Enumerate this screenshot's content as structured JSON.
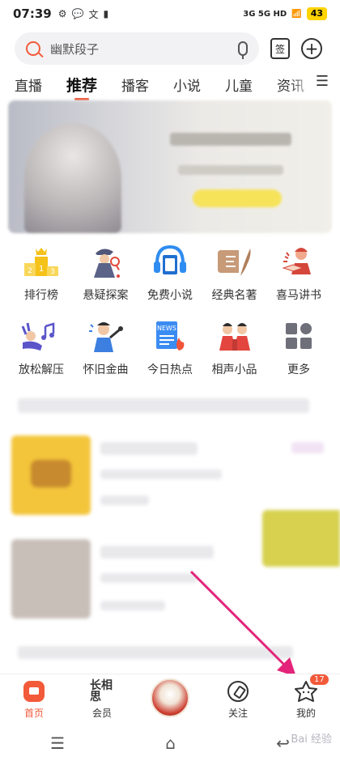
{
  "status_bar": {
    "time": "07:39",
    "network": "3G 5G HD",
    "battery": "43"
  },
  "search": {
    "placeholder": "幽默段子",
    "sign_label": "签"
  },
  "tabs": [
    "直播",
    "推荐",
    "播客",
    "小说",
    "儿童",
    "资讯"
  ],
  "active_tab": "推荐",
  "categories_row1": [
    {
      "label": "排行榜",
      "icon": "podium-icon"
    },
    {
      "label": "悬疑探案",
      "icon": "detective-icon"
    },
    {
      "label": "免费小说",
      "icon": "headphone-book-icon"
    },
    {
      "label": "经典名著",
      "icon": "scroll-quill-icon"
    },
    {
      "label": "喜马讲书",
      "icon": "reader-icon"
    }
  ],
  "categories_row2": [
    {
      "label": "放松解压",
      "icon": "relax-music-icon"
    },
    {
      "label": "怀旧金曲",
      "icon": "singer-icon"
    },
    {
      "label": "今日热点",
      "icon": "news-icon"
    },
    {
      "label": "相声小品",
      "icon": "comedians-icon"
    },
    {
      "label": "更多",
      "icon": "grid-more-icon"
    }
  ],
  "bottom_nav": [
    {
      "label": "首页",
      "icon": "home-icon",
      "active": true
    },
    {
      "label": "会员",
      "icon": "vip-icon",
      "glyph": "长相思"
    },
    {
      "label": "",
      "icon": "center-avatar"
    },
    {
      "label": "关注",
      "icon": "compass-icon"
    },
    {
      "label": "我的",
      "icon": "star-face-icon",
      "badge": "17"
    }
  ],
  "watermark": "Bai 经验",
  "colors": {
    "accent": "#f25a3a",
    "arrow": "#e4247a"
  }
}
